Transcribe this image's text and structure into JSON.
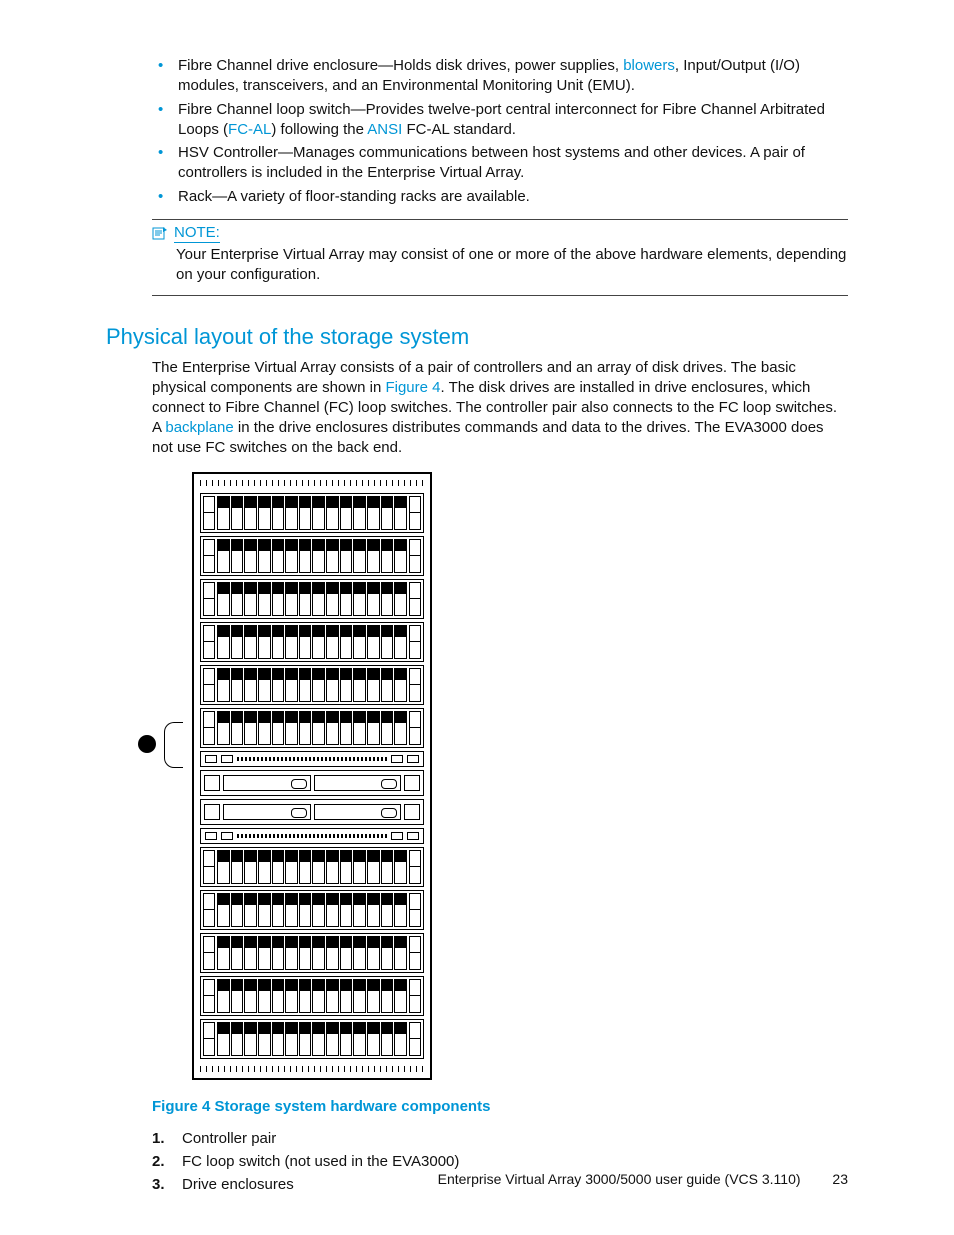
{
  "bullets": [
    {
      "pre": "Fibre Channel drive enclosure—Holds disk drives, power supplies, ",
      "link": "blowers",
      "post": ", Input/Output (I/O) modules, transceivers, and an Environmental Monitoring Unit (EMU)."
    },
    {
      "pre": "Fibre Channel loop switch—Provides twelve-port central interconnect for Fibre Channel Arbitrated Loops (",
      "link": "FC-AL",
      "mid": ") following the ",
      "link2": "ANSI",
      "post": " FC-AL standard."
    },
    {
      "text": "HSV Controller—Manages communications between host systems and other devices. A pair of controllers is included in the Enterprise Virtual Array."
    },
    {
      "text": "Rack—A variety of floor-standing racks are available."
    }
  ],
  "note": {
    "label": "NOTE:",
    "body": "Your Enterprise Virtual Array may consist of one or more of the above hardware elements, depending on your configuration."
  },
  "section_title": "Physical layout of the storage system",
  "paragraph": {
    "p1": "The Enterprise Virtual Array consists of a pair of controllers and an array of disk drives. The basic physical components are shown in ",
    "fig_link": "Figure 4",
    "p2": ". The disk drives are installed in drive enclosures, which connect to Fibre Channel (FC) loop switches. The controller pair also connects to the FC loop switches. A ",
    "bp_link": "backplane",
    "p3": " in the drive enclosures distributes commands and data to the drives. The EVA3000 does not use FC switches on the back end."
  },
  "figure_caption": "Figure 4 Storage system hardware components",
  "figure_items": [
    "Controller pair",
    "FC loop switch (not used in the EVA3000)",
    "Drive enclosures"
  ],
  "footer": {
    "title": "Enterprise Virtual Array 3000/5000 user guide (VCS 3.110)",
    "page": "23"
  }
}
